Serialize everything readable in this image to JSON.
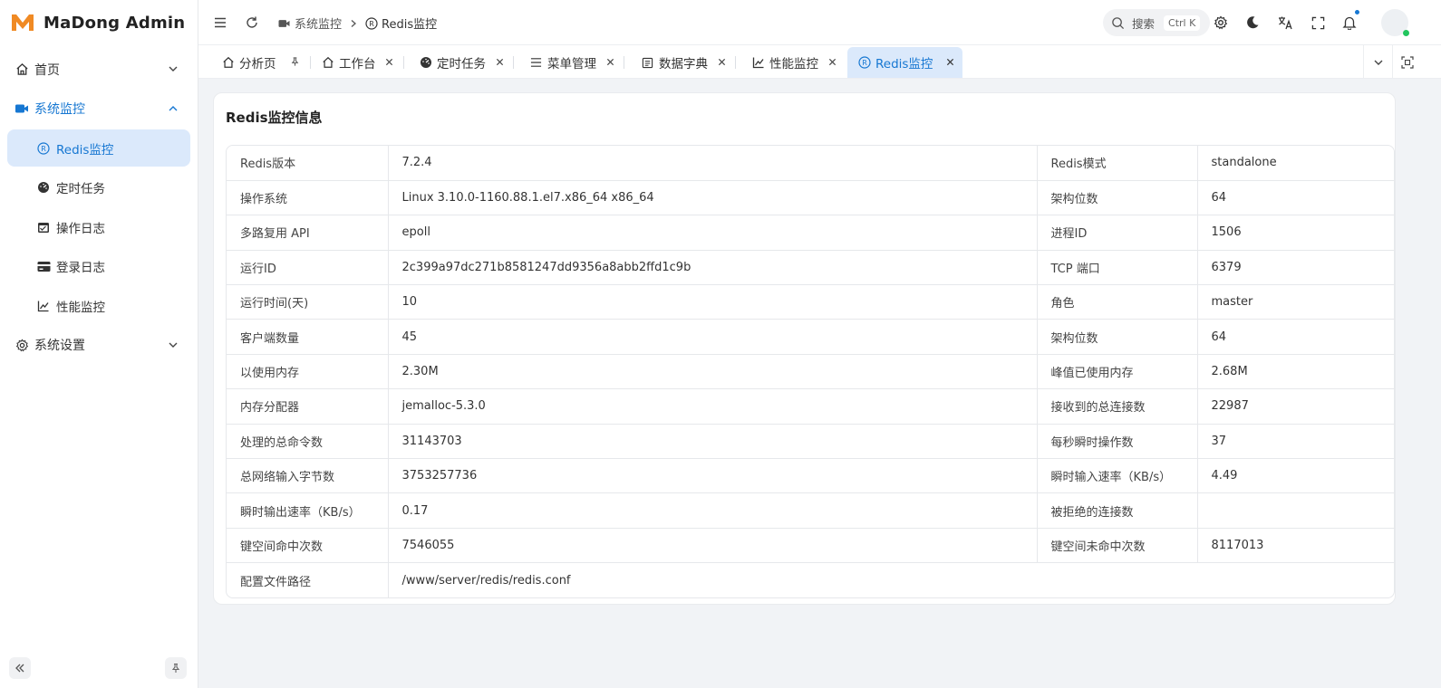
{
  "app": {
    "title": "MaDong Admin",
    "accent": "#1677d2",
    "active_bg": "#dbe9fb"
  },
  "sidebar": {
    "items": [
      {
        "label": "首页",
        "icon": "home-icon"
      },
      {
        "label": "系统监控",
        "icon": "video-icon"
      },
      {
        "label": "Redis监控",
        "icon": "redis-icon"
      },
      {
        "label": "定时任务",
        "icon": "dashboard-icon"
      },
      {
        "label": "操作日志",
        "icon": "calendar-icon"
      },
      {
        "label": "登录日志",
        "icon": "card-icon"
      },
      {
        "label": "性能监控",
        "icon": "line-chart-icon"
      },
      {
        "label": "系统设置",
        "icon": "gear-icon"
      }
    ]
  },
  "header": {
    "breadcrumb": [
      "系统监控",
      "Redis监控"
    ],
    "search_placeholder": "搜索",
    "search_shortcut": "Ctrl K"
  },
  "tabs": [
    {
      "label": "分析页",
      "icon": "home-icon",
      "pinned": true
    },
    {
      "label": "工作台",
      "icon": "home-icon"
    },
    {
      "label": "定时任务",
      "icon": "dashboard-icon"
    },
    {
      "label": "菜单管理",
      "icon": "menu-icon"
    },
    {
      "label": "数据字典",
      "icon": "dictionary-icon"
    },
    {
      "label": "性能监控",
      "icon": "line-chart-icon"
    },
    {
      "label": "Redis监控",
      "icon": "redis-icon",
      "active": true
    }
  ],
  "main": {
    "title": "Redis监控信息",
    "rows": [
      [
        "Redis版本",
        "7.2.4",
        "Redis模式",
        "standalone"
      ],
      [
        "操作系统",
        "Linux 3.10.0-1160.88.1.el7.x86_64 x86_64",
        "架构位数",
        "64"
      ],
      [
        "多路复用 API",
        "epoll",
        "进程ID",
        "1506"
      ],
      [
        "运行ID",
        "2c399a97dc271b8581247dd9356a8abb2ffd1c9b",
        "TCP 端口",
        "6379"
      ],
      [
        "运行时间(天)",
        "10",
        "角色",
        "master"
      ],
      [
        "客户端数量",
        "45",
        "架构位数",
        "64"
      ],
      [
        "以使用内存",
        "2.30M",
        "峰值已使用内存",
        "2.68M"
      ],
      [
        "内存分配器",
        "jemalloc-5.3.0",
        "接收到的总连接数",
        "22987"
      ],
      [
        "处理的总命令数",
        "31143703",
        "每秒瞬时操作数",
        "37"
      ],
      [
        "总网络输入字节数",
        "3753257736",
        "瞬时输入速率（KB/s）",
        "4.49"
      ],
      [
        "瞬时输出速率（KB/s）",
        "0.17",
        "被拒绝的连接数",
        ""
      ],
      [
        "键空间命中次数",
        "7546055",
        "键空间未命中次数",
        "8117013"
      ]
    ],
    "last_row": [
      "配置文件路径",
      "/www/server/redis/redis.conf"
    ]
  }
}
